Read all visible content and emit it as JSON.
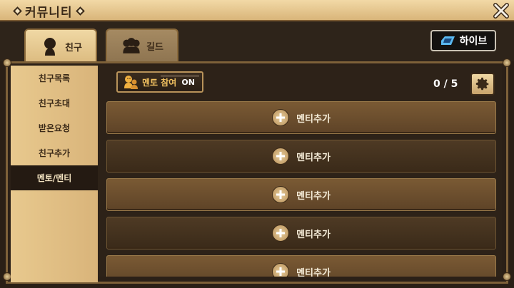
{
  "window": {
    "title": "커뮤니티"
  },
  "tabs": [
    {
      "label": "친구",
      "icon": "person-silhouette-icon",
      "active": true
    },
    {
      "label": "길드",
      "icon": "group-silhouette-icon",
      "active": false
    }
  ],
  "hive": {
    "label": "하이브",
    "icon": "hive-logo-icon"
  },
  "sidebar": {
    "items": [
      {
        "label": "친구목록",
        "active": false
      },
      {
        "label": "친구초대",
        "active": false
      },
      {
        "label": "받은요청",
        "active": false
      },
      {
        "label": "친구추가",
        "active": false
      },
      {
        "label": "멘토/멘티",
        "active": true
      }
    ]
  },
  "mentor": {
    "label": "멘토 참여",
    "state": "ON",
    "icon": "mentor-icon"
  },
  "count": "0 / 5",
  "slots": [
    {
      "label": "멘티추가"
    },
    {
      "label": "멘티추가"
    },
    {
      "label": "멘티추가"
    },
    {
      "label": "멘티추가"
    },
    {
      "label": "멘티추가"
    }
  ],
  "colors": {
    "accent": "#f0c060",
    "panel": "#2d2218",
    "frame": "#7e6139"
  }
}
